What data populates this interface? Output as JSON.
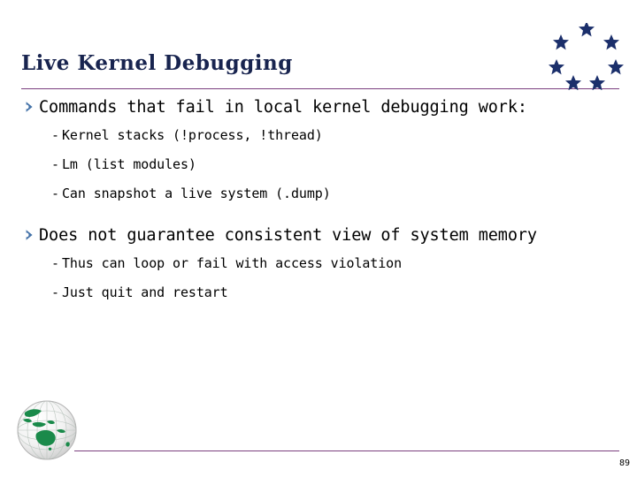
{
  "slide": {
    "title": "Live Kernel Debugging",
    "page_number": "89",
    "title_color": "#18244f",
    "rule_color": "#7b3f7f",
    "bullet_marker_color": "#4472a8",
    "body_text_color": "#000000",
    "background_color": "#ffffff",
    "logo_star_color": "#1b2f6b",
    "globe_land_color": "#1a8a4a"
  },
  "logo": {
    "stars_icon_name": "eu-stars-logo",
    "star_count": 7
  },
  "globe": {
    "icon_name": "globe-icon",
    "region": "Australia / Oceania"
  },
  "content": {
    "blocks": [
      {
        "level1": {
          "marker": "circular-arrow-bullet",
          "text": "Commands that fail in local kernel debugging work:"
        },
        "level2": [
          {
            "dash": "-",
            "text": "Kernel stacks (!process, !thread)"
          },
          {
            "dash": "-",
            "text": "Lm (list modules)"
          },
          {
            "dash": "-",
            "text": "Can snapshot a live system (.dump)"
          }
        ]
      },
      {
        "level1": {
          "marker": "circular-arrow-bullet",
          "text": "Does not guarantee consistent view of system memory"
        },
        "level2": [
          {
            "dash": "-",
            "text": "Thus can loop or fail with access violation"
          },
          {
            "dash": "-",
            "text": "Just quit and restart"
          }
        ]
      }
    ]
  }
}
